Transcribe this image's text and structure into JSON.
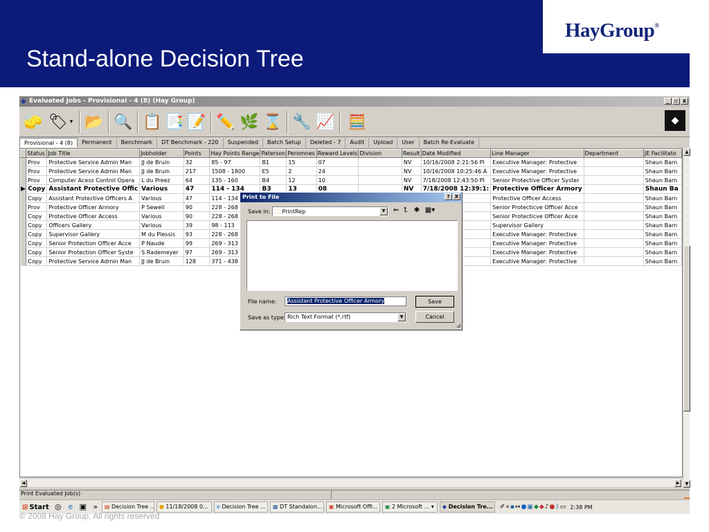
{
  "slide": {
    "title": "Stand-alone Decision Tree",
    "logo": "HayGroup",
    "logo_mark": "®",
    "copyright": "© 2008 Hay Group. All rights reserved"
  },
  "window": {
    "title": "Evaluated Jobs - Provisional - 4 (8) (Hay Group)",
    "controls": [
      "_",
      "▫",
      "x"
    ]
  },
  "toolbar": {
    "icons": [
      "eraser-icon",
      "tag-icon",
      "folder-icon",
      "magnify-icon",
      "report-icon",
      "report-alt-icon",
      "edit-report-icon",
      "pencil-icon",
      "tree-icon",
      "hourglass-icon",
      "evaluate-icon",
      "chart-icon",
      "calculator-icon"
    ]
  },
  "tabs": [
    "Provisional - 4 (8)",
    "Permanent",
    "Benchmark",
    "DT Benchmark - 220",
    "Suspended",
    "Batch Setup",
    "Deleted - 7",
    "Audit",
    "Upload",
    "User",
    "Batch Re-Evaluate"
  ],
  "grid": {
    "columns": [
      "Status",
      "Job Title",
      "Jobholder",
      "Points",
      "Hay Points Range",
      "Paterson",
      "Peromnes",
      "Reward Levels",
      "Division",
      "Result",
      "Date Modified",
      "Line Manager",
      "Department",
      "JE Facilitato"
    ],
    "rows": [
      [
        "Prov",
        "Protective Service Admin Man",
        "JJ de Bruin",
        "32",
        "85 - 97",
        "B1",
        "15",
        "07",
        "",
        "NV",
        "10/16/2008 2:21:56 PI",
        "Executive Manager: Protective",
        "",
        "Shaun Barn"
      ],
      [
        "Prov",
        "Protective Service Admin Man",
        "JJ de Bruin",
        "217",
        "1508 - 1800",
        "E5",
        "2",
        "24",
        "",
        "NV",
        "10/16/2008 10:25:46 A",
        "Executive Manager: Protective",
        "",
        "Shaun Barn"
      ],
      [
        "Prov",
        "Computer Acess Control Opera",
        "L du Preez",
        "64",
        "135 - 160",
        "B4",
        "12",
        "10",
        "",
        "NV",
        "7/18/2008 12:43:50 PI",
        "Senior Protective Officer Syster",
        "",
        "Shaun Barn"
      ],
      [
        "Copy",
        "Assistant Protective Offic",
        "Various",
        "47",
        "114 - 134",
        "B3",
        "13",
        "08",
        "",
        "NV",
        "7/18/2008 12:39:1:",
        "Protective Officer Armory",
        "",
        "Shaun Ba"
      ],
      [
        "Copy",
        "Assistant Protective Officers A",
        "Various",
        "47",
        "114 - 134",
        "",
        "",
        "",
        "",
        "",
        "38:13 PI",
        "Protective Officer Access",
        "",
        "Shaun Barn"
      ],
      [
        "Prov",
        "Protective Officer Armory",
        "P Sewell",
        "90",
        "228 - 268",
        "",
        "",
        "",
        "",
        "",
        "32:37 PI",
        "Senior Protecticve Officer Acce",
        "",
        "Shaun Barn"
      ],
      [
        "Copy",
        "Protective Officer Access",
        "Various",
        "90",
        "228 - 268",
        "",
        "",
        "",
        "",
        "",
        "31:32 PI",
        "Senior Protecticve Officer Acce",
        "",
        "Shaun Barn"
      ],
      [
        "Copy",
        "Officers Gallery",
        "Various",
        "39",
        "98 - 113",
        "",
        "",
        "",
        "",
        "",
        "26:43 PI",
        "Supervisor Gallery",
        "",
        "Shaun Barn"
      ],
      [
        "Copy",
        "Supervisor Gallery",
        "M du Plessis",
        "93",
        "228 - 268",
        "",
        "",
        "",
        "",
        "",
        "18:01 PI",
        "Executive Manager: Protective",
        "",
        "Shaun Barn"
      ],
      [
        "Copy",
        "Senior Protection Officer Acce",
        "P Naude",
        "99",
        "269 - 313",
        "",
        "",
        "",
        "",
        "",
        "06:41 PI",
        "Executive Manager: Protective",
        "",
        "Shaun Barn"
      ],
      [
        "Copy",
        "Senior Protection Officer Syste",
        "S Rademeyer",
        "97",
        "269 - 313",
        "",
        "",
        "",
        "",
        "",
        "58:56 AI",
        "Executive Manager: Protective",
        "",
        "Shaun Barn"
      ],
      [
        "Copy",
        "Protective Service Admin Man",
        "JJ de Bruin",
        "128",
        "371 - 438",
        "",
        "",
        "",
        "",
        "",
        "57:23 AI",
        "Executive Manager: Protective",
        "",
        "Shaun Barn"
      ]
    ],
    "current_row": 3
  },
  "status_text": "Print Evaluated Job(s)",
  "taskbar": {
    "start": "Start",
    "more": "»",
    "tasks": [
      "Decision Tree ...",
      "11/18/2008 0...",
      "Decision Tree ...",
      "DT Standalon...",
      "Microsoft Offi...",
      "2 Microsoft ...",
      "Decision Tre..."
    ],
    "active_task": 6,
    "tray_chevron": "«",
    "clock": "2:38 PM"
  },
  "dialog": {
    "title": "Print to File",
    "help": "?",
    "close": "X",
    "save_in_label": "Save in:",
    "save_in_value": "PrintRep",
    "file_name_label": "File name:",
    "file_name_value": "Assistant Protective Officer Armory",
    "save_as_type_label": "Save as type:",
    "save_as_type_value": "Rich Text Format (*.rtf)",
    "save_button": "Save",
    "cancel_button": "Cancel"
  }
}
